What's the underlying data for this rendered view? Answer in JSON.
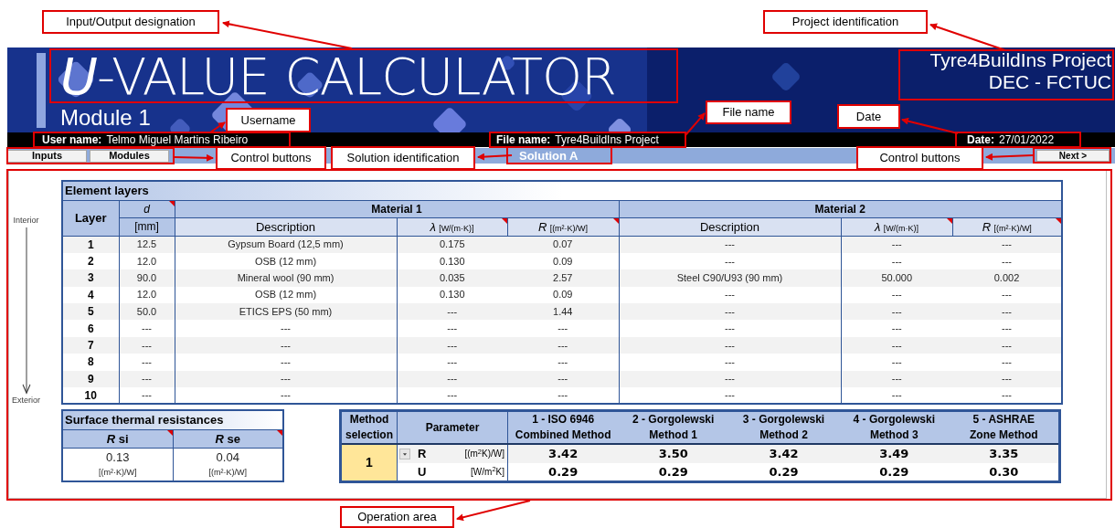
{
  "annotations": [
    {
      "text": "Input/Output designation"
    },
    {
      "text": "Project identification"
    },
    {
      "text": "Username"
    },
    {
      "text": "File name"
    },
    {
      "text": "Date"
    },
    {
      "text": "Control buttons"
    },
    {
      "text": "Solution identification"
    },
    {
      "text": "Control buttons"
    },
    {
      "text": "Operation area"
    }
  ],
  "header": {
    "title": "*U*-VALUE CALCULATOR",
    "subtitle": "Module 1",
    "project": [
      "Tyre4BuildIns Project",
      "DEC - FCTUC"
    ]
  },
  "info_bar": {
    "user_label": "User name:",
    "user": "Telmo Miguel Martins Ribeiro",
    "file_label": "File name:",
    "file": "Tyre4BuildIns Project",
    "date_label": "Date:",
    "date": "27/01/2022"
  },
  "nav": {
    "buttons": [
      "Inputs",
      "Modules"
    ],
    "solution": "Solution A",
    "next": "Next >"
  },
  "layers": {
    "title": "Element layers",
    "interior": "Interior",
    "exterior": "Exterior",
    "layer_header": "Layer",
    "d_header": {
      "symbol": "d",
      "unit": "[mm]"
    },
    "materials": [
      {
        "name": "Material 1",
        "columns": [
          {
            "unit": "Description"
          },
          {
            "symbol": "λ",
            "unit": "[W/(m·K)]"
          },
          {
            "symbol": "R",
            "unit": "[(m²·K)/W]"
          }
        ]
      },
      {
        "name": "Material 2",
        "columns": [
          {
            "unit": "Description"
          },
          {
            "symbol": "λ",
            "unit": "[W/(m·K)]"
          },
          {
            "symbol": "R",
            "unit": "[(m²·K)/W]"
          }
        ]
      }
    ],
    "rows": [
      [
        "1",
        "12.5",
        "Gypsum Board (12,5 mm)",
        "0.175",
        "0.07",
        "---",
        "---",
        "---"
      ],
      [
        "2",
        "12.0",
        "OSB (12 mm)",
        "0.130",
        "0.09",
        "---",
        "---",
        "---"
      ],
      [
        "3",
        "90.0",
        "Mineral wool (90 mm)",
        "0.035",
        "2.57",
        "Steel C90/U93 (90 mm)",
        "50.000",
        "0.002"
      ],
      [
        "4",
        "12.0",
        "OSB (12 mm)",
        "0.130",
        "0.09",
        "---",
        "---",
        "---"
      ],
      [
        "5",
        "50.0",
        "ETICS EPS (50 mm)",
        "---",
        "1.44",
        "---",
        "---",
        "---"
      ],
      [
        "6",
        "---",
        "---",
        "---",
        "---",
        "---",
        "---",
        "---"
      ],
      [
        "7",
        "---",
        "---",
        "---",
        "---",
        "---",
        "---",
        "---"
      ],
      [
        "8",
        "---",
        "---",
        "---",
        "---",
        "---",
        "---",
        "---"
      ],
      [
        "9",
        "---",
        "---",
        "---",
        "---",
        "---",
        "---",
        "---"
      ],
      [
        "10",
        "---",
        "---",
        "---",
        "---",
        "---",
        "---",
        "---"
      ]
    ]
  },
  "surface": {
    "title": "Surface thermal resistances",
    "columns": [
      {
        "header": "*R* si",
        "value": "0.13",
        "unit": "[(m²·K)/W]"
      },
      {
        "header": "*R* se",
        "value": "0.04",
        "unit": "[(m²·K)/W]"
      }
    ]
  },
  "methods": {
    "selection_header": "Method selection",
    "parameter_header": "Parameter",
    "selection": "1",
    "parameters": [
      {
        "symbol": "R",
        "unit": "[(m$^{2}$K)/W]"
      },
      {
        "symbol": "U",
        "unit": "[W/m$^{2}$K]"
      }
    ],
    "columns": [
      {
        "line1": "1 - ISO 6946",
        "line2": "Combined Method",
        "values": [
          "3.42",
          "0.29"
        ]
      },
      {
        "line1": "2 - Gorgolewski",
        "line2": "Method 1",
        "values": [
          "3.50",
          "0.29"
        ]
      },
      {
        "line1": "3 - Gorgolewski",
        "line2": "Method 2",
        "values": [
          "3.42",
          "0.29"
        ]
      },
      {
        "line1": "4 - Gorgolewski",
        "line2": "Method 3",
        "values": [
          "3.49",
          "0.29"
        ]
      },
      {
        "line1": "5 - ASHRAE",
        "line2": "Zone Method",
        "values": [
          "3.35",
          "0.30"
        ]
      }
    ]
  }
}
